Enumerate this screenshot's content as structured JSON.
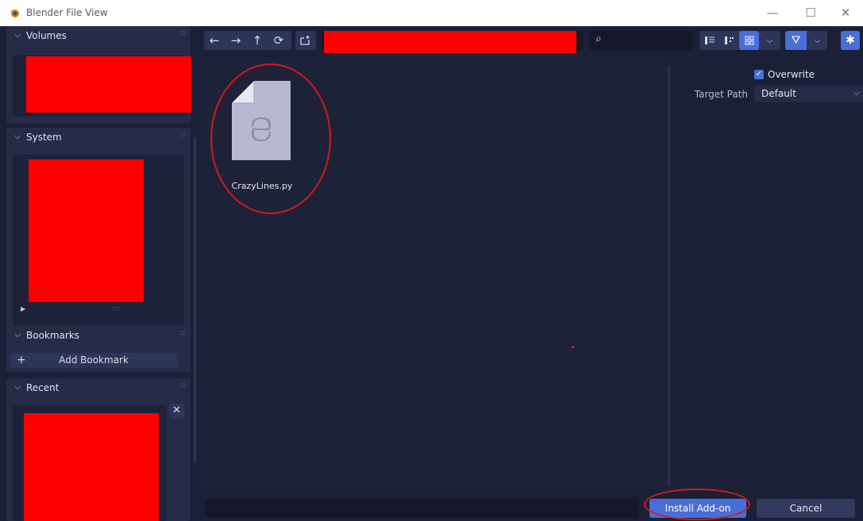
{
  "window": {
    "title": "Blender File View",
    "minimize": "—",
    "maximize": "☐",
    "close": "✕"
  },
  "sidebar": {
    "panels": [
      {
        "label": "Volumes"
      },
      {
        "label": "System"
      },
      {
        "label": "Bookmarks"
      },
      {
        "label": "Recent"
      }
    ],
    "add_bookmark_label": "Add Bookmark",
    "remove_recent_label": "✕"
  },
  "toolbar": {
    "back": "←",
    "forward": "→",
    "parent": "↑",
    "refresh": "⟳",
    "search_icon": "⌕"
  },
  "files": [
    {
      "name": "CrazyLines.py",
      "icon": "python-file-icon"
    }
  ],
  "options": {
    "overwrite_label": "Overwrite",
    "overwrite_checked": true,
    "target_path_label": "Target Path",
    "target_path_value": "Default"
  },
  "footer": {
    "install_label": "Install Add-on",
    "cancel_label": "Cancel"
  },
  "colors": {
    "accent": "#4a6ed8",
    "background": "#1b2036",
    "panel": "#262c48",
    "annotation": "#d11a1a",
    "redaction": "#ff0000"
  }
}
